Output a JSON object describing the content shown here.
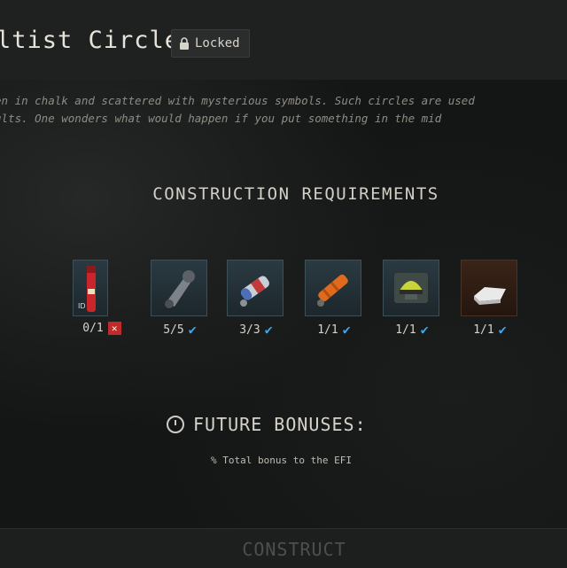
{
  "header": {
    "title": "ltist Circle",
    "status_badge": {
      "label": "Locked",
      "icon": "lock-icon"
    }
  },
  "description": {
    "line1": "en in chalk and scattered with mysterious symbols. Such circles are used",
    "line2": "ults. One wonders what would happen if you put something in the mid"
  },
  "requirements": {
    "title": "CONSTRUCTION REQUIREMENTS",
    "items": [
      {
        "icon": "red-tube-item-icon",
        "count": "0/1",
        "status": "missing"
      },
      {
        "icon": "gray-tool-item-icon",
        "count": "5/5",
        "status": "met"
      },
      {
        "icon": "blue-red-capsule-item-icon",
        "count": "3/3",
        "status": "met"
      },
      {
        "icon": "orange-item-icon",
        "count": "1/1",
        "status": "met"
      },
      {
        "icon": "helmet-item-icon",
        "count": "1/1",
        "status": "met"
      },
      {
        "icon": "white-block-item-icon",
        "count": "1/1",
        "status": "met"
      }
    ]
  },
  "future_bonuses": {
    "title": "FUTURE BONUSES:",
    "bonus_text": "% Total bonus to the EFI"
  },
  "construct_button": {
    "label": "CONSTRUCT"
  },
  "colors": {
    "check": "#41a6e6",
    "missing": "#c02a2a",
    "tile_border": "#3c5058"
  }
}
